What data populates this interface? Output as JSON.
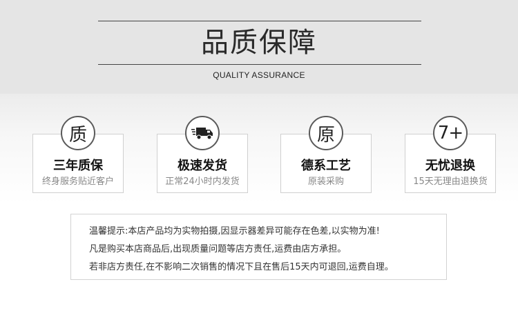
{
  "header": {
    "title": "品质保障",
    "subtitle": "QUALITY ASSURANCE"
  },
  "features": [
    {
      "icon_text": "质",
      "title": "三年质保",
      "subtitle": "终身服务贴近客户"
    },
    {
      "icon_text": "",
      "icon": "truck-icon",
      "title": "极速发货",
      "subtitle": "正常24小时内发货"
    },
    {
      "icon_text": "原",
      "title": "德系工艺",
      "subtitle": "原装采购"
    },
    {
      "icon_text": "7+",
      "title": "无忧退换",
      "subtitle": "15天无理由退换货"
    }
  ],
  "notice": {
    "lines": [
      "温馨提示:本店产品均为实物拍摄,因显示器差异可能存在色差,以实物为准!",
      "凡是购买本店商品后,出现质量问题等店方责任,运费由店方承担。",
      "若非店方责任,在不影响二次销售的情况下且在售后15天内可退回,运费自理。"
    ]
  }
}
